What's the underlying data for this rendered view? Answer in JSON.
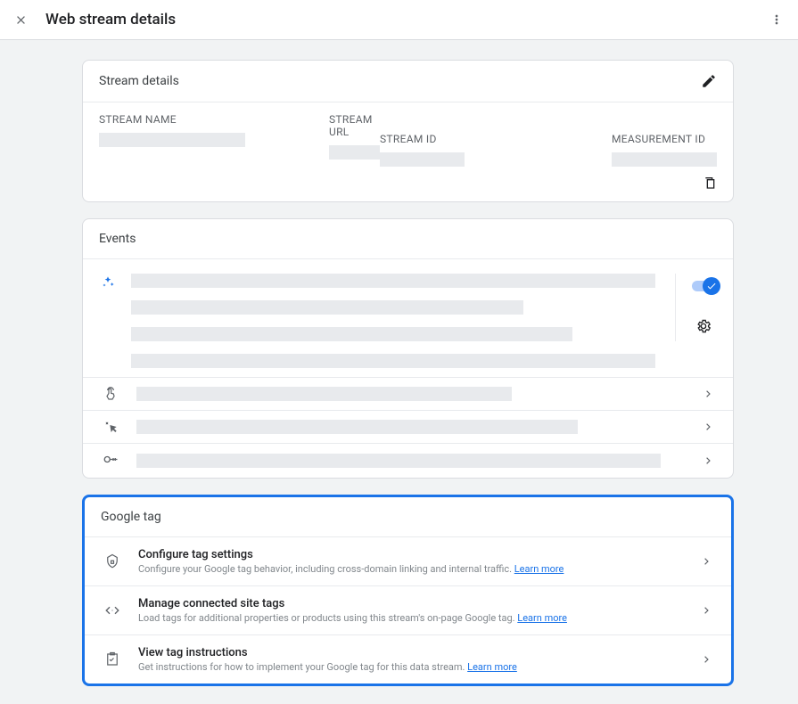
{
  "header": {
    "title": "Web stream details"
  },
  "stream": {
    "card_title": "Stream details",
    "name_label": "STREAM NAME",
    "url_label": "STREAM URL",
    "id_label": "STREAM ID",
    "measurement_label": "MEASUREMENT ID"
  },
  "events": {
    "card_title": "Events"
  },
  "tag": {
    "card_title": "Google tag",
    "items": [
      {
        "title": "Configure tag settings",
        "desc": "Configure your Google tag behavior, including cross-domain linking and internal traffic.",
        "learn": "Learn more"
      },
      {
        "title": "Manage connected site tags",
        "desc": "Load tags for additional properties or products using this stream's on-page Google tag.",
        "learn": "Learn more"
      },
      {
        "title": "View tag instructions",
        "desc": "Get instructions for how to implement your Google tag for this data stream.",
        "learn": "Learn more"
      }
    ]
  }
}
